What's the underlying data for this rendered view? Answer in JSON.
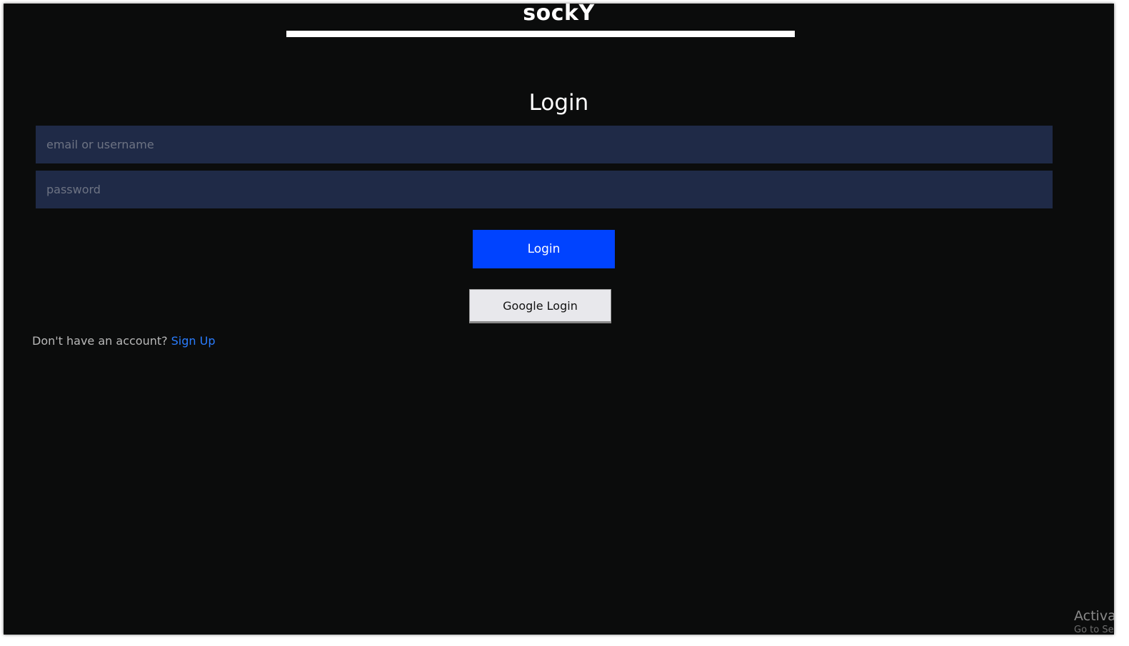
{
  "brand": {
    "title": "sockY"
  },
  "login": {
    "heading": "Login",
    "username_placeholder": "email or username",
    "password_placeholder": "password",
    "login_button": "Login",
    "google_button": "Google Login",
    "signup_prompt": "Don't have an account?",
    "signup_link": "Sign Up"
  },
  "watermark": {
    "line1": "Activa",
    "line2": "Go to Se"
  },
  "colors": {
    "background": "#0b0c0c",
    "input_background": "#1f2a47",
    "primary_button": "#0043ff",
    "link": "#2a7dff"
  }
}
